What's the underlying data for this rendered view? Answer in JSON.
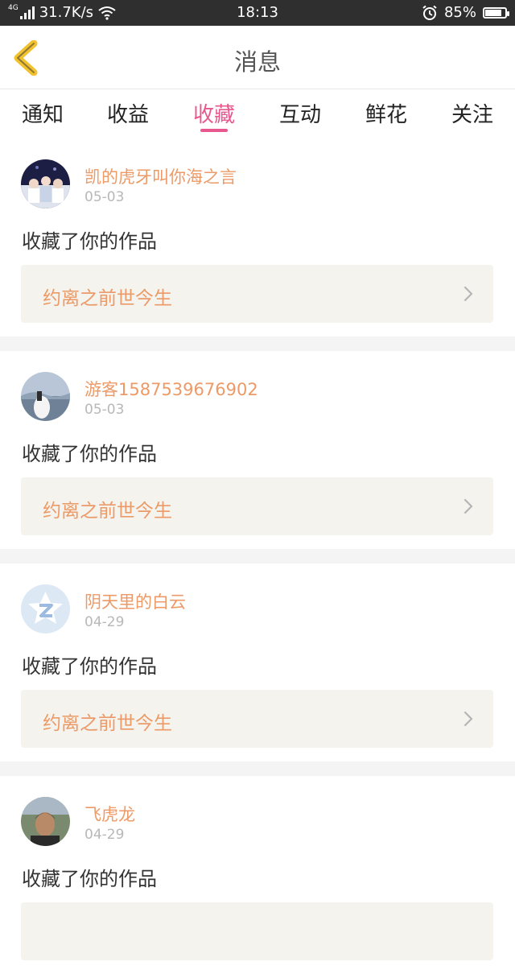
{
  "status_bar": {
    "network_type": "4G",
    "speed": "31.7K/s",
    "time": "18:13",
    "battery_percent": "85%",
    "battery_level": 0.85,
    "icons": [
      "signal-icon",
      "wifi-icon",
      "alarm-icon",
      "battery-icon"
    ]
  },
  "header": {
    "title": "消息",
    "back_icon": "chevron-left-icon",
    "back_color": "#f2c12e"
  },
  "tabs": [
    {
      "label": "通知",
      "active": false
    },
    {
      "label": "收益",
      "active": false
    },
    {
      "label": "收藏",
      "active": true
    },
    {
      "label": "互动",
      "active": false
    },
    {
      "label": "鲜花",
      "active": false
    },
    {
      "label": "关注",
      "active": false
    }
  ],
  "colors": {
    "accent": "#e8588e",
    "username": "#ec9a68",
    "card_bg": "#f4f3ee"
  },
  "messages": [
    {
      "username": "凯的虎牙叫你海之言",
      "date": "05-03",
      "action": "收藏了你的作品",
      "work_title": "约离之前世今生"
    },
    {
      "username": "游客1587539676902",
      "date": "05-03",
      "action": "收藏了你的作品",
      "work_title": "约离之前世今生"
    },
    {
      "username": "阴天里的白云",
      "date": "04-29",
      "action": "收藏了你的作品",
      "work_title": "约离之前世今生"
    },
    {
      "username": "飞虎龙",
      "date": "04-29",
      "action": "收藏了你的作品",
      "work_title": ""
    }
  ]
}
